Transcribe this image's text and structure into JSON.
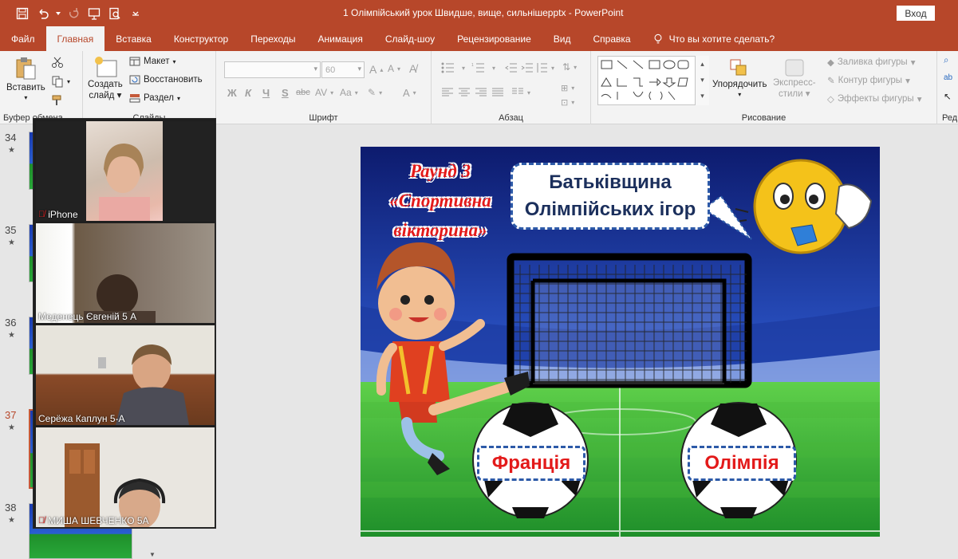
{
  "window": {
    "title": "1 Олімпійський урок Швидше, вище, сильнішеpptx  -  PowerPoint",
    "signin_label": "Вход"
  },
  "tabs": [
    {
      "label": "Файл"
    },
    {
      "label": "Главная",
      "active": true
    },
    {
      "label": "Вставка"
    },
    {
      "label": "Конструктор"
    },
    {
      "label": "Переходы"
    },
    {
      "label": "Анимация"
    },
    {
      "label": "Слайд-шоу"
    },
    {
      "label": "Рецензирование"
    },
    {
      "label": "Вид"
    },
    {
      "label": "Справка"
    }
  ],
  "tell_me": "Что вы хотите сделать?",
  "ribbon": {
    "clipboard": {
      "paste": "Вставить",
      "label": "Буфер обмена"
    },
    "slides": {
      "new_slide_1": "Создать",
      "new_slide_2": "слайд",
      "layout": "Макет",
      "reset": "Восстановить",
      "section": "Раздел",
      "label": "Слайды"
    },
    "font": {
      "size": "60",
      "label": "Шрифт",
      "bold": "Ж",
      "italic": "К",
      "underline": "Ч",
      "shadow": "S",
      "strike": "abc",
      "case": "Aa"
    },
    "paragraph": {
      "label": "Абзац"
    },
    "drawing": {
      "arrange_1": "Упорядочить",
      "express_1": "Экспресс-",
      "express_2": "стили",
      "fill": "Заливка фигуры",
      "outline": "Контур фигуры",
      "effects": "Эффекты фигуры",
      "label": "Рисование"
    },
    "editing": {
      "label": "Ред"
    }
  },
  "thumbnails": [
    {
      "num": "34"
    },
    {
      "num": "35"
    },
    {
      "num": "36"
    },
    {
      "num": "37",
      "current": true
    },
    {
      "num": "38"
    }
  ],
  "zoom": {
    "participants": [
      {
        "name": "iPhone",
        "muted": true
      },
      {
        "name": "Меденець Євгеній 5 А",
        "muted": false
      },
      {
        "name": "Серёжа Каплун 5-А",
        "muted": false
      },
      {
        "name": "МИША ШЕВЧЕНКО 5А",
        "muted": true
      }
    ]
  },
  "slide": {
    "round_line1": "Раунд 3",
    "round_line2": "«Спортивна",
    "round_line3": "вікторина»",
    "question_line1": "Батьківщина",
    "question_line2": "Олімпійських ігор",
    "answer_left": "Франція",
    "answer_right": "Олімпія"
  },
  "colors": {
    "brand": "#b7472a",
    "answer_text": "#e31a1a",
    "bubble_border": "#2d5aa8"
  }
}
